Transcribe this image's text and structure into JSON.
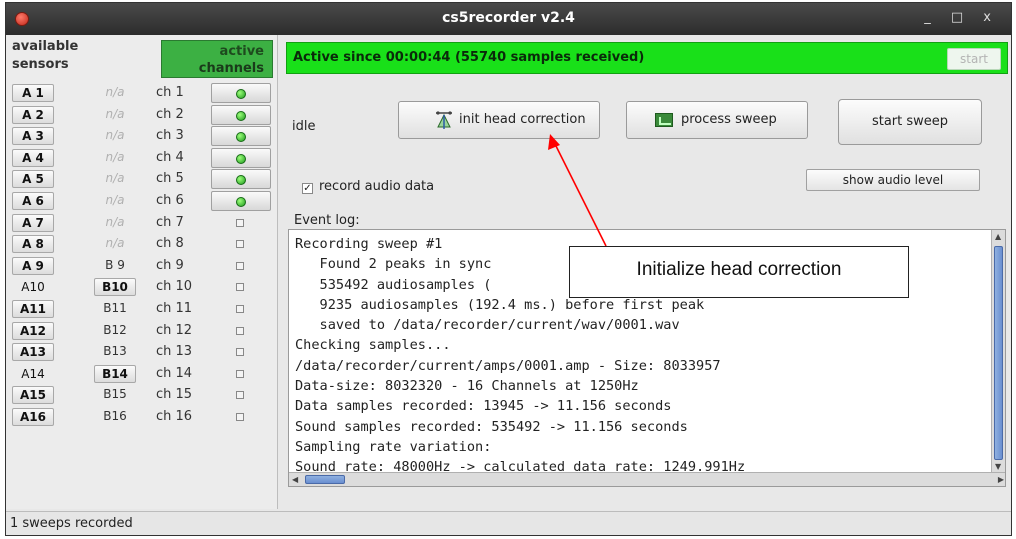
{
  "window": {
    "title": "cs5recorder v2.4",
    "controls": "_ □ x"
  },
  "left": {
    "header_available_l1": "available",
    "header_available_l2": "sensors",
    "header_active_l1": "active",
    "header_active_l2": "channels",
    "rows": [
      {
        "a": "A 1",
        "b": "n/a",
        "ch": "ch 1",
        "on": true
      },
      {
        "a": "A 2",
        "b": "n/a",
        "ch": "ch 2",
        "on": true
      },
      {
        "a": "A 3",
        "b": "n/a",
        "ch": "ch 3",
        "on": true
      },
      {
        "a": "A 4",
        "b": "n/a",
        "ch": "ch 4",
        "on": true
      },
      {
        "a": "A 5",
        "b": "n/a",
        "ch": "ch 5",
        "on": true
      },
      {
        "a": "A 6",
        "b": "n/a",
        "ch": "ch 6",
        "on": true
      },
      {
        "a": "A 7",
        "b": "n/a",
        "ch": "ch 7",
        "on": false
      },
      {
        "a": "A 8",
        "b": "n/a",
        "ch": "ch 8",
        "on": false
      },
      {
        "a": "A 9",
        "b": "B 9",
        "ch": "ch 9",
        "on": false
      },
      {
        "a": "A10",
        "b": "B10",
        "ch": "ch 10",
        "on": false
      },
      {
        "a": "A11",
        "b": "B11",
        "ch": "ch 11",
        "on": false
      },
      {
        "a": "A12",
        "b": "B12",
        "ch": "ch 12",
        "on": false
      },
      {
        "a": "A13",
        "b": "B13",
        "ch": "ch 13",
        "on": false
      },
      {
        "a": "A14",
        "b": "B14",
        "ch": "ch 14",
        "on": false
      },
      {
        "a": "A15",
        "b": "B15",
        "ch": "ch 15",
        "on": false
      },
      {
        "a": "A16",
        "b": "B16",
        "ch": "ch 16",
        "on": false
      }
    ]
  },
  "right": {
    "status": "Active since 00:00:44 (55740 samples received)",
    "start_label": "start",
    "state_label": "idle",
    "init_label": "init head correction",
    "process_label": "process sweep",
    "sweep_label": "start sweep",
    "record_audio_label": "record audio data",
    "record_audio_checked": "✓",
    "audio_level_label": "show audio level",
    "event_log_label": "Event log:",
    "log": [
      "Recording sweep #1",
      "   Found 2 peaks in sync",
      "   535492 audiosamples (",
      "   9235 audiosamples (192.4 ms.) before first peak",
      "   saved to /data/recorder/current/wav/0001.wav",
      "Checking samples...",
      "/data/recorder/current/amps/0001.amp - Size: 8033957",
      "Data-size: 8032320 - 16 Channels at 1250Hz",
      "Data samples recorded: 13945 -> 11.156 seconds",
      "Sound samples recorded: 535492 -> 11.156 seconds",
      "Sampling rate variation:",
      "Sound rate: 48000Hz -> calculated data rate: 1249.991Hz"
    ]
  },
  "bottom": {
    "status": "1 sweeps recorded"
  },
  "annotation": {
    "text": "Initialize head correction"
  },
  "colors": {
    "active_green": "#19e019",
    "header_green": "#3cb043",
    "arrow": "#ff0000"
  }
}
